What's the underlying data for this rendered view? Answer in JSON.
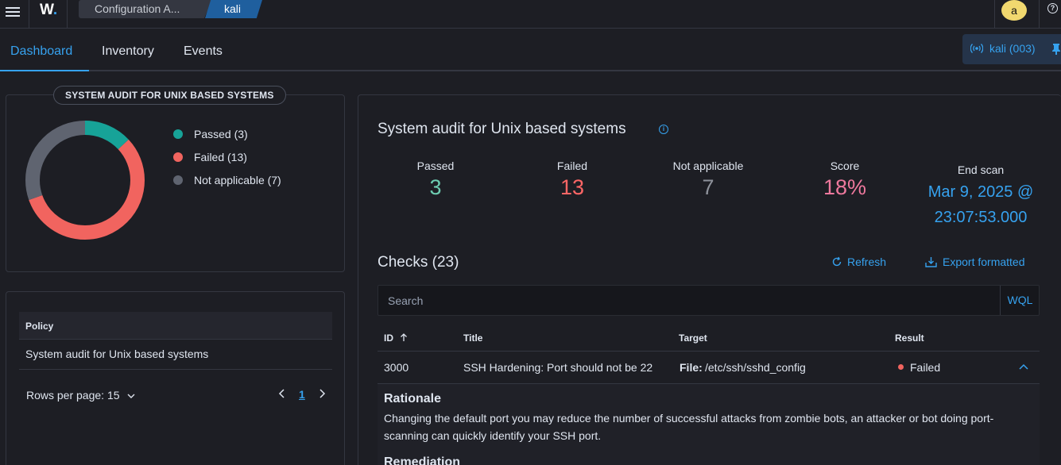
{
  "header": {
    "logo": "W",
    "breadcrumbs": [
      "Configuration A...",
      "kali"
    ],
    "avatar_initial": "a",
    "help_label": "?"
  },
  "tabs": [
    "Dashboard",
    "Inventory",
    "Events"
  ],
  "agent_pill": "kali (003)",
  "legend_panel": {
    "title": "SYSTEM AUDIT FOR UNIX BASED SYSTEMS",
    "items": [
      {
        "label": "Passed (3)",
        "color": "#17a398",
        "value": 3
      },
      {
        "label": "Failed (13)",
        "color": "#f1645f",
        "value": 13
      },
      {
        "label": "Not applicable (7)",
        "color": "#5f6470",
        "value": 7
      }
    ]
  },
  "policy_table": {
    "header": "Policy",
    "rows": [
      "System audit for Unix based systems"
    ],
    "rows_per_page": "Rows per page: 15",
    "current_page": "1"
  },
  "summary": {
    "title": "System audit for Unix based systems",
    "stats": [
      {
        "label": "Passed",
        "value": "3",
        "color": "#6dccb1"
      },
      {
        "label": "Failed",
        "value": "13",
        "color": "#f66"
      },
      {
        "label": "Not applicable",
        "value": "7",
        "color": "#8e929b"
      },
      {
        "label": "Score",
        "value": "18%",
        "color": "#ee789d"
      }
    ],
    "end_scan_label": "End scan",
    "end_scan_value_line1": "Mar 9, 2025 @",
    "end_scan_value_line2": "23:07:53.000"
  },
  "checks": {
    "title": "Checks (23)",
    "refresh": "Refresh",
    "export": "Export formatted",
    "search_placeholder": "Search",
    "wql": "WQL",
    "columns": [
      "ID",
      "Title",
      "Target",
      "Result"
    ],
    "rows": [
      {
        "id": "3000",
        "title": "SSH Hardening: Port should not be 22",
        "target_key": "File:",
        "target_value": "/etc/ssh/sshd_config",
        "result": "Failed"
      }
    ],
    "expanded": {
      "rationale_heading": "Rationale",
      "rationale_text": "Changing the default port you may reduce the number of successful attacks from zombie bots, an attacker or bot doing port-scanning can quickly identify your SSH port.",
      "remediation_heading": "Remediation"
    }
  }
}
